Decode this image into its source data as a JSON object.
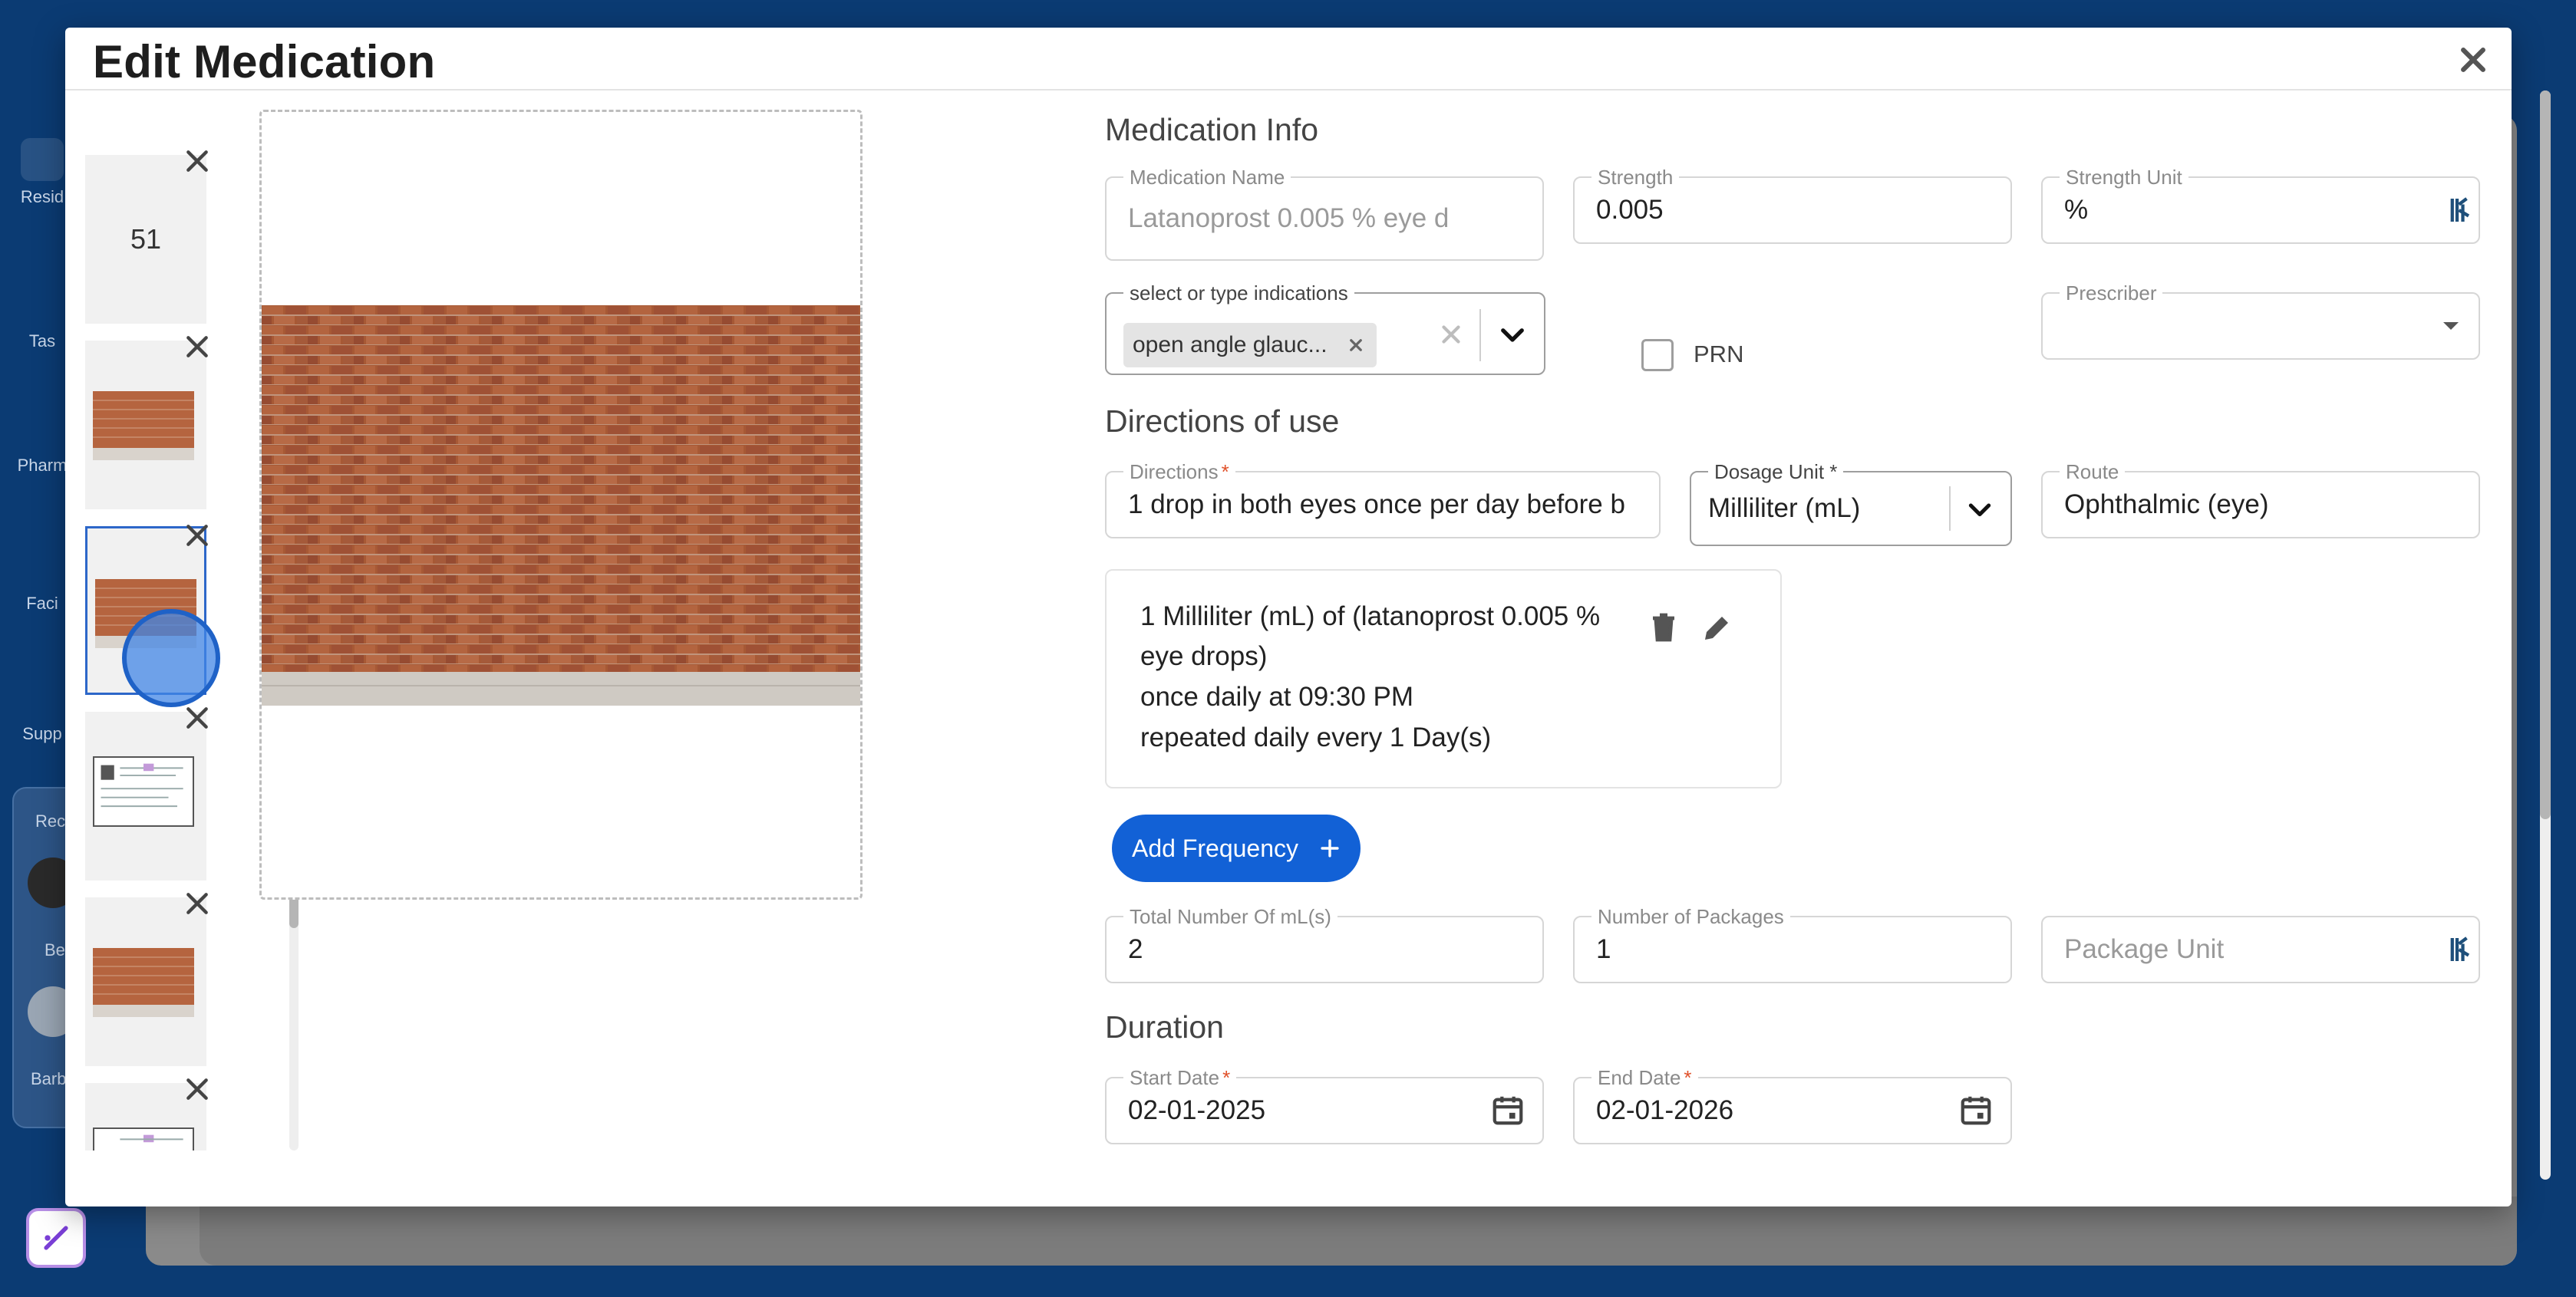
{
  "background": {
    "nav": [
      {
        "label": "Resid",
        "icon": "person-icon"
      },
      {
        "label": "Tas",
        "icon": "check-icon"
      },
      {
        "label": "Pharm",
        "icon": "gear-icon"
      },
      {
        "label": "Faci",
        "icon": "home-plus-icon"
      },
      {
        "label": "Supp",
        "icon": "help-icon"
      }
    ],
    "card": {
      "heading": "Rec",
      "user1": "Be",
      "user2": "Barb"
    }
  },
  "modal": {
    "title": "Edit Medication",
    "close_icon": "close-icon"
  },
  "thumbnails": [
    {
      "type": "number",
      "label": "51"
    },
    {
      "type": "photo"
    },
    {
      "type": "photo",
      "selected": true
    },
    {
      "type": "document"
    },
    {
      "type": "photo"
    },
    {
      "type": "document"
    }
  ],
  "form": {
    "medication_info": {
      "title": "Medication Info",
      "medication_name": {
        "label": "Medication Name",
        "value": "Latanoprost 0.005 % eye d"
      },
      "strength": {
        "label": "Strength",
        "value": "0.005"
      },
      "strength_unit": {
        "label": "Strength Unit",
        "value": "%"
      },
      "indications": {
        "label": "select or type indications",
        "chip": "open angle glauc..."
      },
      "prn": {
        "label": "PRN",
        "checked": false
      },
      "prescriber": {
        "label": "Prescriber",
        "value": ""
      }
    },
    "directions": {
      "title": "Directions of use",
      "directions": {
        "label": "Directions",
        "value": "1 drop in both eyes once per day before b"
      },
      "dosage_unit": {
        "label": "Dosage Unit *",
        "value": "Milliliter (mL)"
      },
      "route": {
        "label": "Route",
        "value": "Ophthalmic (eye)"
      },
      "frequency_card": {
        "line1": "1 Milliliter (mL) of (latanoprost 0.005 %",
        "line2": "eye drops)",
        "line3": "once daily at 09:30 PM",
        "line4": "repeated daily every 1 Day(s)"
      },
      "add_frequency_label": "Add Frequency",
      "total_number": {
        "label": "Total Number Of mL(s)",
        "value": "2"
      },
      "packages": {
        "label": "Number of Packages",
        "value": "1"
      },
      "package_unit": {
        "placeholder": "Package Unit"
      }
    },
    "duration": {
      "title": "Duration",
      "start_date": {
        "label": "Start Date",
        "value": "02-01-2025"
      },
      "end_date": {
        "label": "End Date",
        "value": "02-01-2026"
      }
    }
  },
  "colors": {
    "primary_button": "#1261d6",
    "background": "#0b3b73",
    "required": "#e0512a"
  }
}
